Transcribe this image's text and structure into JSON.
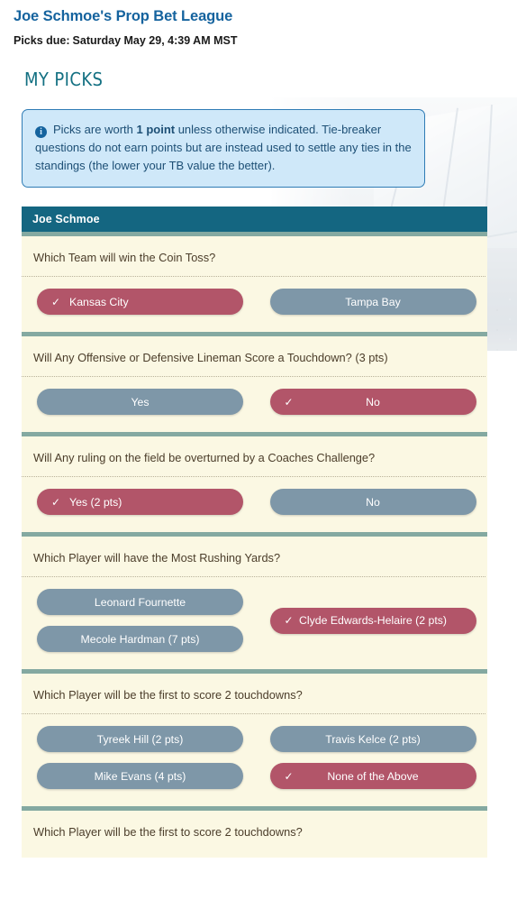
{
  "header": {
    "league_title": "Joe Schmoe's Prop Bet League",
    "picks_due_label": "Picks due:",
    "picks_due_value": "Saturday May 29, 4:39 AM MST",
    "section_title": "MY PICKS",
    "title_color": "#15639e",
    "section_title_color": "#137082"
  },
  "alert": {
    "icon": "info-circle-icon",
    "icon_glyph": "i",
    "text_before": "Picks are worth ",
    "bold_text": "1 point",
    "text_after": " unless otherwise indicated. Tie-breaker questions do not earn points but are instead used to settle any ties in the standings (the lower your TB value the better).",
    "bg_color": "#cfe8f9",
    "border_color": "#2f7cb5"
  },
  "card": {
    "owner_name": "Joe Schmoe",
    "header_color": "#146681",
    "divider_color": "#84a9a1",
    "body_color": "#fbf8e3",
    "selected_color": "#b25569",
    "unselected_color": "#7e97a8",
    "check_glyph": "✓"
  },
  "questions": [
    {
      "text": "Which Team will win the Coin Toss?",
      "layout": "grid",
      "left": [
        {
          "label": "Kansas City",
          "selected": true,
          "center_label": false
        }
      ],
      "right": [
        {
          "label": "Tampa Bay",
          "selected": false,
          "center_label": false
        }
      ]
    },
    {
      "text": "Will Any Offensive or Defensive Lineman Score a Touchdown? (3 pts)",
      "layout": "grid",
      "left": [
        {
          "label": "Yes",
          "selected": false,
          "center_label": false
        }
      ],
      "right": [
        {
          "label": "No",
          "selected": true,
          "center_label": true
        }
      ]
    },
    {
      "text": "Will Any ruling on the field be overturned by a Coaches Challenge?",
      "layout": "grid",
      "left": [
        {
          "label": "Yes (2 pts)",
          "selected": true,
          "center_label": false
        }
      ],
      "right": [
        {
          "label": "No",
          "selected": false,
          "center_label": false
        }
      ]
    },
    {
      "text": "Which Player will have the Most Rushing Yards?",
      "layout": "grid-centered-right",
      "left": [
        {
          "label": "Leonard Fournette",
          "selected": false,
          "center_label": false
        },
        {
          "label": "Mecole Hardman (7 pts)",
          "selected": false,
          "center_label": false
        }
      ],
      "right": [
        {
          "label": "Clyde Edwards-Helaire (2 pts)",
          "selected": true,
          "center_label": true
        }
      ]
    },
    {
      "text": "Which Player will be the first to score 2 touchdowns?",
      "layout": "grid",
      "left": [
        {
          "label": "Tyreek Hill (2 pts)",
          "selected": false,
          "center_label": false
        },
        {
          "label": "Mike Evans (4 pts)",
          "selected": false,
          "center_label": false
        }
      ],
      "right": [
        {
          "label": "Travis Kelce (2 pts)",
          "selected": false,
          "center_label": false
        },
        {
          "label": "None of the Above",
          "selected": true,
          "center_label": true
        }
      ]
    },
    {
      "text": "Which Player will be the first to score 2 touchdowns?",
      "layout": "grid",
      "left": [],
      "right": []
    }
  ]
}
